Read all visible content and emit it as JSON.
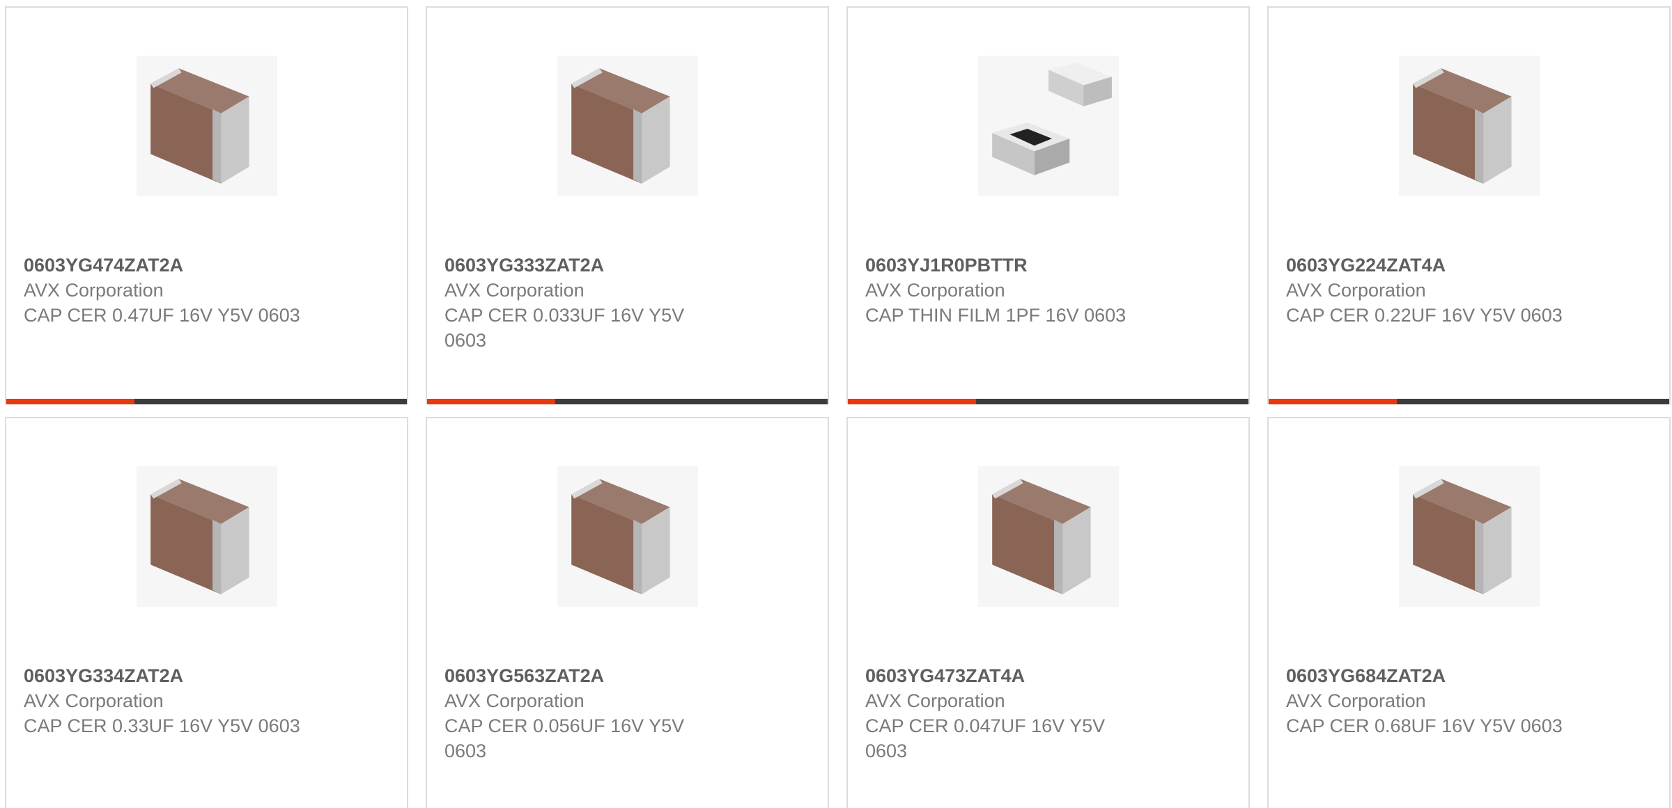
{
  "products": [
    {
      "part_number": "0603YG474ZAT2A",
      "manufacturer": "AVX Corporation",
      "description": "CAP CER 0.47UF 16V Y5V 0603",
      "image_icon": "capacitor-chip-icon",
      "progress": 0.32
    },
    {
      "part_number": "0603YG333ZAT2A",
      "manufacturer": "AVX Corporation",
      "description": "CAP CER 0.033UF 16V Y5V 0603",
      "image_icon": "capacitor-chip-icon",
      "progress": 0.32
    },
    {
      "part_number": "0603YJ1R0PBTTR",
      "manufacturer": "AVX Corporation",
      "description": "CAP THIN FILM 1PF 16V 0603",
      "image_icon": "thin-film-chip-icon",
      "progress": 0.32
    },
    {
      "part_number": "0603YG224ZAT4A",
      "manufacturer": "AVX Corporation",
      "description": "CAP CER 0.22UF 16V Y5V 0603",
      "image_icon": "capacitor-chip-icon",
      "progress": 0.32
    },
    {
      "part_number": "0603YG334ZAT2A",
      "manufacturer": "AVX Corporation",
      "description": "CAP CER 0.33UF 16V Y5V 0603",
      "image_icon": "capacitor-chip-icon"
    },
    {
      "part_number": "0603YG563ZAT2A",
      "manufacturer": "AVX Corporation",
      "description": "CAP CER 0.056UF 16V Y5V 0603",
      "image_icon": "capacitor-chip-icon"
    },
    {
      "part_number": "0603YG473ZAT4A",
      "manufacturer": "AVX Corporation",
      "description": "CAP CER 0.047UF 16V Y5V 0603",
      "image_icon": "capacitor-chip-icon"
    },
    {
      "part_number": "0603YG684ZAT2A",
      "manufacturer": "AVX Corporation",
      "description": "CAP CER 0.68UF 16V Y5V 0603",
      "image_icon": "capacitor-chip-icon"
    }
  ],
  "colors": {
    "accent": "#e8380d",
    "bar_track": "#3c3c3c",
    "border": "#dcdcdc",
    "text": "#7a7a7a"
  }
}
